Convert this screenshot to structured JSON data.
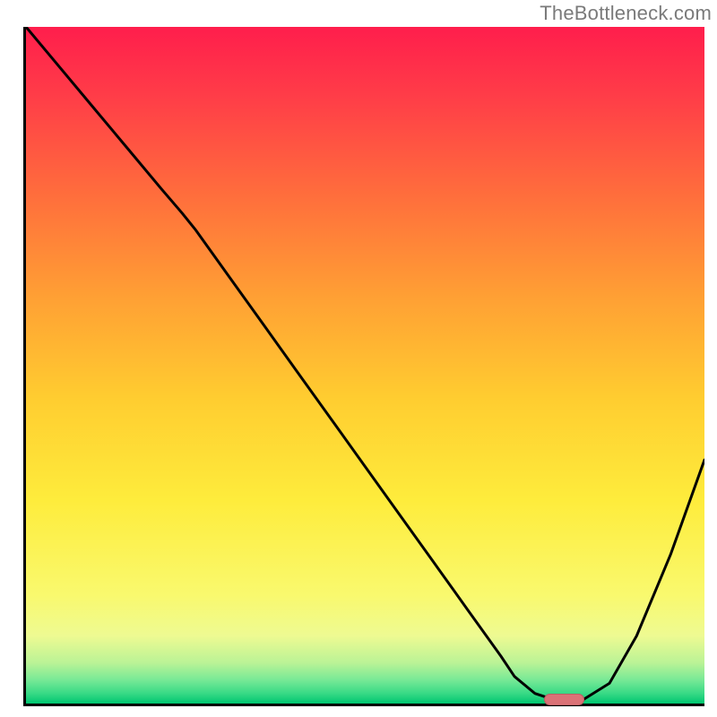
{
  "attribution": "TheBottleneck.com",
  "colors": {
    "gradient_top": "#ff1e4c",
    "gradient_bottom": "#00c570",
    "curve": "#000000",
    "marker": "#db7277",
    "axis": "#000000",
    "attribution_text": "#7a7a7a"
  },
  "chart_data": {
    "type": "line",
    "title": "",
    "xlabel": "",
    "ylabel": "",
    "xlim": [
      0,
      100
    ],
    "ylim": [
      0,
      100
    ],
    "grid": false,
    "legend": false,
    "series": [
      {
        "name": "bottleneck-curve",
        "x": [
          0,
          5,
          10,
          15,
          20,
          23,
          25,
          30,
          35,
          40,
          45,
          50,
          55,
          60,
          65,
          70,
          72,
          75,
          78,
          82,
          86,
          90,
          95,
          100
        ],
        "y": [
          100,
          94,
          88,
          82,
          76,
          72.5,
          70,
          63,
          56,
          49,
          42,
          35,
          28,
          21,
          14,
          7,
          4,
          1.5,
          0.5,
          0.5,
          3,
          10,
          22,
          36
        ]
      }
    ],
    "marker": {
      "name": "highlight-range",
      "x_range": [
        76,
        82
      ],
      "y": 0.5
    }
  }
}
